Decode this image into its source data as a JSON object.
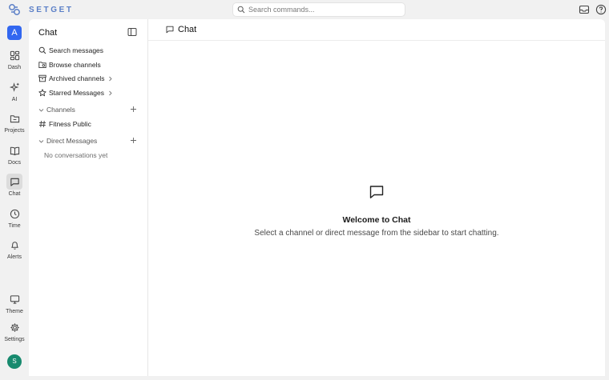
{
  "brand": {
    "name": "SETGET",
    "accent": "#5b7fc7"
  },
  "search": {
    "placeholder": "Search commands..."
  },
  "topbar_icons": [
    "inbox-icon",
    "help-icon"
  ],
  "workspace": {
    "initial": "A",
    "color": "#3267f0"
  },
  "rail": {
    "items": [
      {
        "label": "Dash",
        "icon": "dashboard-icon"
      },
      {
        "label": "AI",
        "icon": "sparkles-icon"
      },
      {
        "label": "Projects",
        "icon": "folder-icon"
      },
      {
        "label": "Docs",
        "icon": "book-icon"
      },
      {
        "label": "Chat",
        "icon": "chat-icon",
        "active": true
      },
      {
        "label": "Time",
        "icon": "clock-icon"
      },
      {
        "label": "Alerts",
        "icon": "bell-icon"
      }
    ],
    "bottom": [
      {
        "label": "Theme",
        "icon": "monitor-icon"
      },
      {
        "label": "Settings",
        "icon": "gear-icon"
      }
    ],
    "user_initial": "S",
    "user_color": "#178a6e"
  },
  "sidebar": {
    "title": "Chat",
    "items": [
      {
        "label": "Search messages",
        "icon": "search-icon"
      },
      {
        "label": "Browse channels",
        "icon": "folder-search-icon"
      },
      {
        "label": "Archived channels",
        "icon": "archive-icon"
      },
      {
        "label": "Starred Messages",
        "icon": "star-icon"
      }
    ],
    "channels": {
      "label": "Channels",
      "items": [
        {
          "label": "Fitness Public",
          "icon": "hash-icon"
        }
      ]
    },
    "direct_messages": {
      "label": "Direct Messages",
      "empty": "No conversations yet"
    }
  },
  "main": {
    "header_title": "Chat",
    "welcome_title": "Welcome to Chat",
    "welcome_subtitle": "Select a channel or direct message from the sidebar to start chatting."
  }
}
